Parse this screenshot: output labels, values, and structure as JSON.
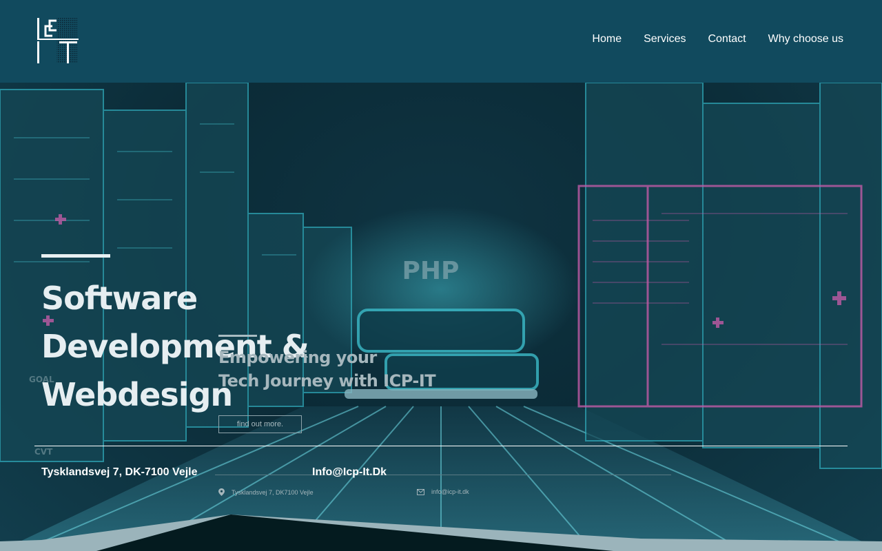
{
  "header": {
    "logo_alt": "ICP-IT",
    "nav": [
      {
        "label": "Home"
      },
      {
        "label": "Services"
      },
      {
        "label": "Contact"
      },
      {
        "label": "Why choose us"
      }
    ]
  },
  "hero": {
    "title": "Software Development & Webdesign",
    "inner_title_line1": "Empowering your",
    "inner_title_line2": "Tech Journey with ICP-IT",
    "inner_button": "find out more.",
    "bg_text": "PHP",
    "bg_label": "GOAL",
    "bg_label2": "CVT"
  },
  "contact": {
    "address": "Tysklandsvej 7, DK-7100 Vejle",
    "email": "Info@Icp-It.Dk",
    "small_address": "Tysklandsvej 7, DK7100 Vejle",
    "small_email": "info@icp-it.dk"
  },
  "colors": {
    "header_bg": "#114a5e",
    "hero_bg": "#0e3a4b",
    "neon_cyan": "#2fc4d3",
    "neon_pink": "#c05ba6"
  }
}
